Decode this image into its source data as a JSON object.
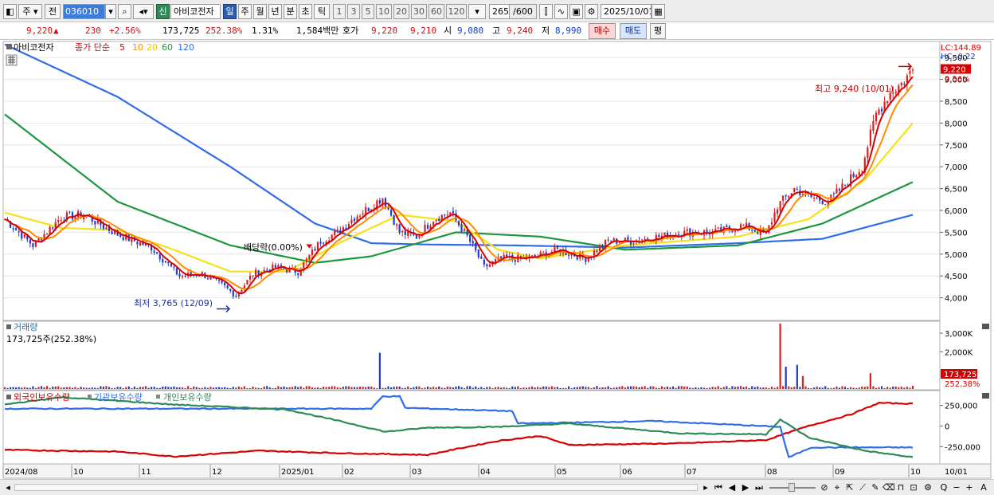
{
  "toolbar": {
    "market_label": "주",
    "prev_label": "전",
    "stock_code": "036010",
    "new_label": "신",
    "stock_name": "아비코전자",
    "period_tabs": [
      "일",
      "주",
      "월",
      "년",
      "분",
      "초",
      "틱"
    ],
    "active_period": "일",
    "interval_options": [
      "1",
      "3",
      "5",
      "10",
      "20",
      "30",
      "60",
      "120"
    ],
    "count_value": "265",
    "count_total": "/600",
    "date_value": "2025/10/01"
  },
  "quote": {
    "price": "9,220",
    "change_arrow": "▲",
    "change": "230",
    "change_pct": "+2.56%",
    "volume": "173,725",
    "volume_ratio": "252.38%",
    "turnover": "1.31%",
    "amount": "1,584백만",
    "bid_label": "호가",
    "bid_sell": "9,220",
    "bid_buy": "9,210",
    "open_label": "시",
    "open": "9,080",
    "high_label": "고",
    "high": "9,240",
    "low_label": "저",
    "low": "8,990",
    "buy_button": "매수",
    "sell_button": "매도",
    "avg_button": "평"
  },
  "colors": {
    "candle_up": "#d82020",
    "candle_down": "#1f3cc8",
    "ma5": "#d80000",
    "ma10": "#ff8c00",
    "ma20": "#f5e21a",
    "ma60": "#1e9640",
    "ma120": "#2f6ee6",
    "foreign": "#d80000",
    "institution": "#2f6ee6",
    "individual": "#2e8b57"
  },
  "chart_data": [
    {
      "type": "candlestick",
      "legend_name": "아비코전자",
      "legend_label": "종가 단순",
      "ma_periods": [
        "5",
        "10",
        "20",
        "60",
        "120"
      ],
      "lc_label": "LC:144.89",
      "hc_label": "HC:-0.22",
      "y_ticks": [
        "9,500",
        "9,000",
        "8,500",
        "8,000",
        "7,500",
        "7,000",
        "6,500",
        "6,000",
        "5,500",
        "5,000",
        "4,500",
        "4,000"
      ],
      "y_tick_values": [
        9500,
        9000,
        8500,
        8000,
        7500,
        7000,
        6500,
        6000,
        5500,
        5000,
        4500,
        4000
      ],
      "ylim": [
        3500,
        9850
      ],
      "last_price_badge": "9,220",
      "last_price_value": 9220,
      "last_pct_badge": "2.56%",
      "annotations": {
        "high": "최고 9,240 (10/01)",
        "high_value": 9240,
        "low": "최저 3,765 (12/09)",
        "low_value": 3765,
        "dividend": "배당락(0.00%)"
      },
      "x_labels": [
        "2024/08",
        "10",
        "11",
        "12",
        "2025/01",
        "02",
        "03",
        "04",
        "05",
        "06",
        "07",
        "08",
        "09",
        "10",
        "10/01"
      ],
      "anchors": [
        {
          "i": 0,
          "p": 5800
        },
        {
          "i": 10,
          "p": 5200
        },
        {
          "i": 20,
          "p": 5850
        },
        {
          "i": 28,
          "p": 5900
        },
        {
          "i": 40,
          "p": 5450
        },
        {
          "i": 52,
          "p": 5150
        },
        {
          "i": 62,
          "p": 4500
        },
        {
          "i": 70,
          "p": 4550
        },
        {
          "i": 78,
          "p": 4250
        },
        {
          "i": 82,
          "p": 4050
        },
        {
          "i": 88,
          "p": 4550
        },
        {
          "i": 96,
          "p": 4700
        },
        {
          "i": 104,
          "p": 4600
        },
        {
          "i": 112,
          "p": 5300
        },
        {
          "i": 118,
          "p": 5500
        },
        {
          "i": 124,
          "p": 5850
        },
        {
          "i": 130,
          "p": 6100
        },
        {
          "i": 134,
          "p": 6300
        },
        {
          "i": 140,
          "p": 5500
        },
        {
          "i": 146,
          "p": 5400
        },
        {
          "i": 152,
          "p": 5800
        },
        {
          "i": 158,
          "p": 5950
        },
        {
          "i": 164,
          "p": 5400
        },
        {
          "i": 170,
          "p": 4700
        },
        {
          "i": 176,
          "p": 4900
        },
        {
          "i": 186,
          "p": 4900
        },
        {
          "i": 196,
          "p": 5100
        },
        {
          "i": 206,
          "p": 4900
        },
        {
          "i": 214,
          "p": 5300
        },
        {
          "i": 222,
          "p": 5300
        },
        {
          "i": 232,
          "p": 5400
        },
        {
          "i": 242,
          "p": 5500
        },
        {
          "i": 252,
          "p": 5500
        },
        {
          "i": 262,
          "p": 5650
        },
        {
          "i": 270,
          "p": 5450
        },
        {
          "i": 274,
          "p": 6100
        },
        {
          "i": 280,
          "p": 6500
        },
        {
          "i": 286,
          "p": 6300
        },
        {
          "i": 292,
          "p": 6200
        },
        {
          "i": 298,
          "p": 6600
        },
        {
          "i": 304,
          "p": 7000
        },
        {
          "i": 309,
          "p": 8200
        },
        {
          "i": 314,
          "p": 8700
        },
        {
          "i": 318,
          "p": 8900
        },
        {
          "i": 322,
          "p": 9220
        }
      ],
      "ma_anchors": {
        "ma120": [
          [
            0,
            9800
          ],
          [
            40,
            8600
          ],
          [
            80,
            7000
          ],
          [
            110,
            5700
          ],
          [
            130,
            5250
          ],
          [
            150,
            5220
          ],
          [
            180,
            5200
          ],
          [
            220,
            5150
          ],
          [
            260,
            5250
          ],
          [
            290,
            5350
          ],
          [
            322,
            5900
          ]
        ],
        "ma60": [
          [
            0,
            8200
          ],
          [
            40,
            6200
          ],
          [
            80,
            5200
          ],
          [
            110,
            4800
          ],
          [
            130,
            4950
          ],
          [
            160,
            5500
          ],
          [
            190,
            5400
          ],
          [
            220,
            5100
          ],
          [
            260,
            5200
          ],
          [
            290,
            5700
          ],
          [
            322,
            6650
          ]
        ],
        "ma20": [
          [
            0,
            5950
          ],
          [
            20,
            5600
          ],
          [
            40,
            5550
          ],
          [
            60,
            5100
          ],
          [
            80,
            4600
          ],
          [
            100,
            4600
          ],
          [
            120,
            5300
          ],
          [
            140,
            5900
          ],
          [
            160,
            5750
          ],
          [
            175,
            5100
          ],
          [
            190,
            4900
          ],
          [
            220,
            5200
          ],
          [
            260,
            5400
          ],
          [
            285,
            5800
          ],
          [
            305,
            6700
          ],
          [
            322,
            8000
          ]
        ]
      }
    },
    {
      "type": "bar",
      "legend_name": "거래량",
      "volume_label": "173,725주(252.38%)",
      "y_ticks": [
        "3,000K",
        "2,000K"
      ],
      "y_tick_values": [
        3000,
        2000
      ],
      "ylim": [
        0,
        3600
      ],
      "last_volume_badge": "173,725",
      "last_volume_value": 173.725,
      "last_ratio_badge": "252.38%",
      "spikes": [
        {
          "i": 133,
          "v": 1950
        },
        {
          "i": 275,
          "v": 3520
        },
        {
          "i": 277,
          "v": 1200
        },
        {
          "i": 281,
          "v": 1300
        },
        {
          "i": 283,
          "v": 700
        },
        {
          "i": 307,
          "v": 850
        }
      ]
    },
    {
      "type": "line",
      "series": [
        {
          "name": "외국인보유수량",
          "key": "foreign",
          "points": [
            [
              0,
              -290000
            ],
            [
              40,
              -310000
            ],
            [
              60,
              -370000
            ],
            [
              90,
              -300000
            ],
            [
              120,
              -330000
            ],
            [
              150,
              -350000
            ],
            [
              160,
              -280000
            ],
            [
              175,
              -180000
            ],
            [
              190,
              -120000
            ],
            [
              200,
              -230000
            ],
            [
              240,
              -210000
            ],
            [
              270,
              -170000
            ],
            [
              285,
              0
            ],
            [
              300,
              140000
            ],
            [
              310,
              280000
            ],
            [
              322,
              270000
            ]
          ]
        },
        {
          "name": "기관보유수량",
          "key": "institution",
          "points": [
            [
              0,
              210000
            ],
            [
              130,
              210000
            ],
            [
              134,
              360000
            ],
            [
              140,
              360000
            ],
            [
              142,
              220000
            ],
            [
              180,
              180000
            ],
            [
              182,
              30000
            ],
            [
              230,
              60000
            ],
            [
              275,
              -10000
            ],
            [
              278,
              -380000
            ],
            [
              286,
              -260000
            ],
            [
              322,
              -260000
            ]
          ]
        },
        {
          "name": "개인보유수량",
          "key": "individual",
          "points": [
            [
              0,
              260000
            ],
            [
              20,
              350000
            ],
            [
              60,
              260000
            ],
            [
              100,
              200000
            ],
            [
              120,
              50000
            ],
            [
              135,
              -70000
            ],
            [
              150,
              -20000
            ],
            [
              175,
              -10000
            ],
            [
              200,
              30000
            ],
            [
              240,
              -90000
            ],
            [
              270,
              -100000
            ],
            [
              275,
              80000
            ],
            [
              285,
              -140000
            ],
            [
              305,
              -300000
            ],
            [
              322,
              -380000
            ]
          ]
        }
      ],
      "y_ticks": [
        "250,000",
        "0",
        "-250,000"
      ],
      "y_tick_values": [
        250000,
        0,
        -250000
      ],
      "ylim": [
        -450000,
        420000
      ]
    }
  ],
  "bottombar": {
    "zoom_label": "Q",
    "minus_label": "−",
    "plus_label": "+",
    "a_label": "A"
  }
}
